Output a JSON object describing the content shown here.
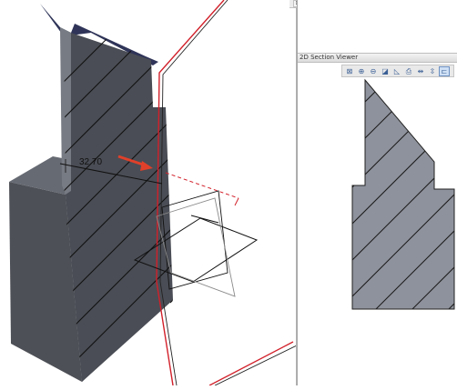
{
  "viewport": {
    "dimension_value": "32.70"
  },
  "section_viewer": {
    "title": "2D Section Viewer",
    "toolbar_icons": [
      "fit-icon",
      "zoom-in-icon",
      "zoom-out-icon",
      "view-icon",
      "view-angle-icon",
      "export-icon",
      "flip-horizontal-icon",
      "flip-vertical-icon",
      "sync-icon"
    ]
  },
  "top_toolbar": {
    "icons": [
      "select-icon",
      "measure-icon",
      "copy-icon",
      "search-icon",
      "camera-icon",
      "tools-icon",
      "text-icon",
      "arrows-icon",
      "settings-icon",
      "highlight-icon",
      "grid-icon",
      "section-icon"
    ]
  },
  "colors": {
    "solid_gray": "#4e5057",
    "section_fill": "#8e929c",
    "accent_red": "#e0402a",
    "plane_red": "#d2202a",
    "toolbar_active": "#cfe0f5"
  }
}
